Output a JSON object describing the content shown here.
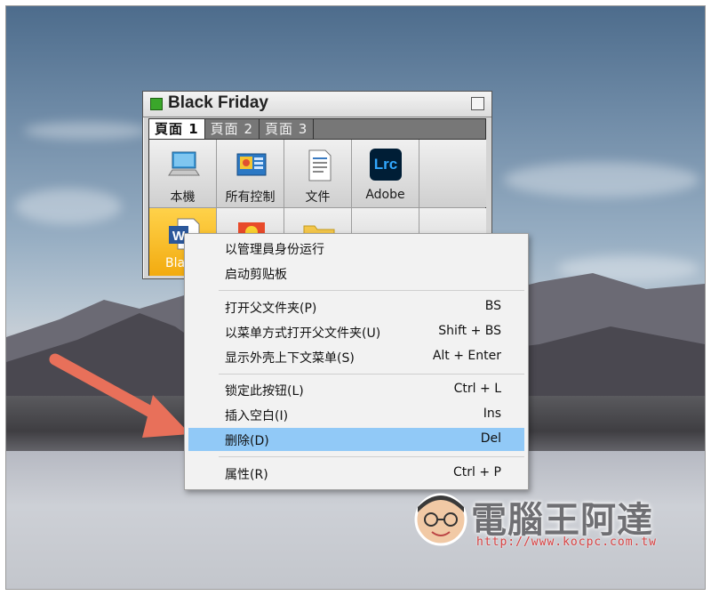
{
  "window": {
    "title": "Black Friday",
    "tabs": [
      {
        "label": "頁面 1",
        "active": true
      },
      {
        "label": "頁面 2",
        "active": false
      },
      {
        "label": "頁面 3",
        "active": false
      }
    ],
    "cells": [
      {
        "label": "本機",
        "icon": "computer-icon"
      },
      {
        "label": "所有控制",
        "icon": "control-panel-icon"
      },
      {
        "label": "文件",
        "icon": "document-icon"
      },
      {
        "label": "Adobe",
        "icon": "lightroom-classic-icon",
        "icon_text": "Lrc"
      },
      {
        "label": "",
        "icon": ""
      },
      {
        "label": "Bla",
        "icon": "word-icon",
        "icon_text": "W",
        "selected": true
      },
      {
        "label": "",
        "icon": "media-icon"
      },
      {
        "label": "",
        "icon": "folder-icon"
      },
      {
        "label": "",
        "icon": ""
      },
      {
        "label": "",
        "icon": ""
      }
    ]
  },
  "context_menu": {
    "groups": [
      [
        {
          "label": "以管理員身份运行",
          "shortcut": ""
        },
        {
          "label": "启动剪贴板",
          "shortcut": ""
        }
      ],
      [
        {
          "label": "打开父文件夹(P)",
          "shortcut": "BS"
        },
        {
          "label": "以菜单方式打开父文件夹(U)",
          "shortcut": "Shift + BS"
        },
        {
          "label": "显示外壳上下文菜单(S)",
          "shortcut": "Alt + Enter"
        }
      ],
      [
        {
          "label": "锁定此按钮(L)",
          "shortcut": "Ctrl + L"
        },
        {
          "label": "插入空白(I)",
          "shortcut": "Ins"
        },
        {
          "label": "删除(D)",
          "shortcut": "Del",
          "highlighted": true
        }
      ],
      [
        {
          "label": "属性(R)",
          "shortcut": "Ctrl + P"
        }
      ]
    ]
  },
  "watermark": {
    "title": "電腦王阿達",
    "url": "http://www.kocpc.com.tw"
  },
  "colors": {
    "highlight": "#91c9f7",
    "selected_cell": "#f2ab10",
    "arrow": "#e8705a",
    "title_square": "#3aa62a"
  }
}
